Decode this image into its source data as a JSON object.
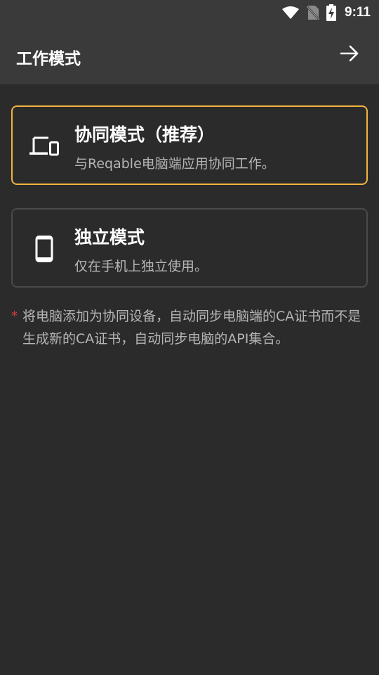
{
  "status_bar": {
    "time": "9:11",
    "icons": [
      "wifi-icon",
      "no-sim-icon",
      "battery-charging-icon"
    ]
  },
  "app_bar": {
    "title": "工作模式",
    "action_icon": "arrow-right-icon"
  },
  "modes": [
    {
      "title": "协同模式（推荐）",
      "description": "与Reqable电脑端应用协同工作。",
      "icon": "devices-icon",
      "selected": true,
      "accent_color": "#f2b340"
    },
    {
      "title": "独立模式",
      "description": "仅在手机上独立使用。",
      "icon": "smartphone-icon",
      "selected": false
    }
  ],
  "note": {
    "marker": "*",
    "marker_color": "#d83c3c",
    "text": "将电脑添加为协同设备，自动同步电脑端的CA证书而不是生成新的CA证书，自动同步电脑的API集合。"
  }
}
